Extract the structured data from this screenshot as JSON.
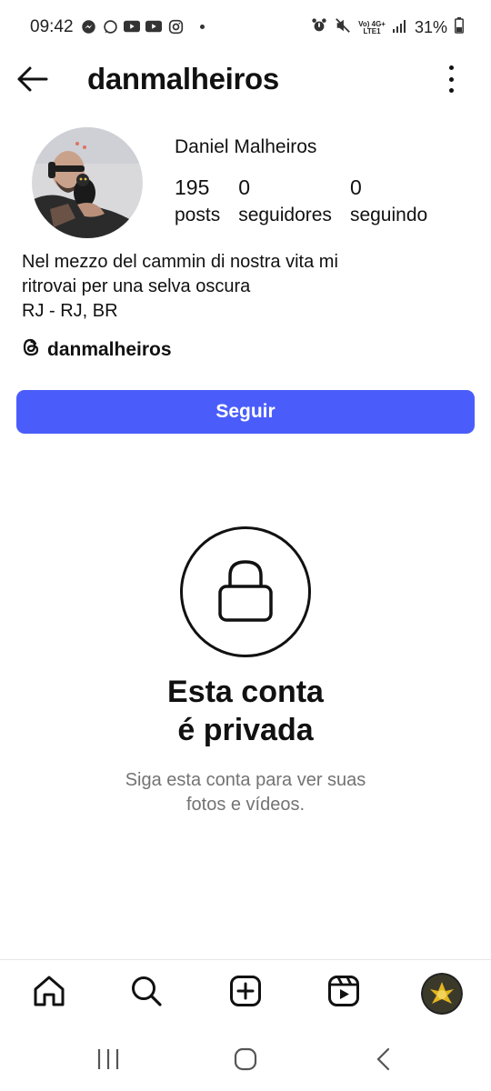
{
  "status_bar": {
    "time": "09:42",
    "battery": "31%",
    "network_top": "Vo) 4G+",
    "network_bottom": "LTE1",
    "left_icons": [
      "messenger-icon",
      "whatsapp-icon",
      "youtube-icon",
      "youtube-icon",
      "instagram-icon"
    ],
    "right_icons": [
      "alarm-icon",
      "mute-icon",
      "signal-icon",
      "battery-icon"
    ]
  },
  "header": {
    "username": "danmalheiros",
    "back_icon": "arrow-left-icon",
    "more_icon": "more-vertical-icon"
  },
  "profile": {
    "full_name": "Daniel Malheiros",
    "stats": [
      {
        "value": "195",
        "label": "posts"
      },
      {
        "value": "0",
        "label": "seguidores"
      },
      {
        "value": "0",
        "label": "seguindo"
      }
    ],
    "bio_lines": [
      "Nel mezzo del cammin di nostra vita mi",
      "ritrovai per una selva oscura",
      "RJ - RJ, BR"
    ],
    "threads_handle": "danmalheiros",
    "follow_label": "Seguir",
    "follow_color": "#4a5dfb"
  },
  "private": {
    "title_line1": "Esta conta",
    "title_line2": "é privada",
    "subtitle_line1": "Siga esta conta para ver suas",
    "subtitle_line2": "fotos e vídeos."
  },
  "bottom_nav": {
    "items": [
      "home-icon",
      "search-icon",
      "create-icon",
      "reels-icon",
      "profile-avatar"
    ]
  },
  "system_nav": {
    "items": [
      "recents-icon",
      "home-button-icon",
      "back-button-icon"
    ]
  }
}
